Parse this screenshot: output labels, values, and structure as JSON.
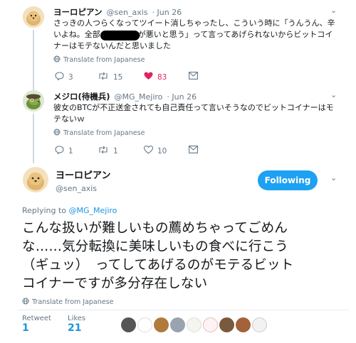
{
  "tweet1": {
    "name": "ヨーロピアン",
    "handle": "@sen_axis",
    "date": "· Jun 26",
    "line1": "さっきの人つらくなってツイート消しちゃったし、こういう時に「うんうん、辛",
    "line2a": "いよね。全部",
    "line2b": "が悪いと思う」って言ってあげられないからビットコイ",
    "line3": "ナーはモテないんだと思いました",
    "translate": "Translate from Japanese",
    "replies": "3",
    "retweets": "15",
    "likes": "83"
  },
  "tweet2": {
    "name": "メジロ(待機兵)",
    "handle": "@MG_Mejiro",
    "date": "· Jun 26",
    "line1": "彼女のBTCが不正送金されても自己責任って言いそうなのでビットコイナーはモ",
    "line2": "テないｗ",
    "translate": "Translate from Japanese",
    "replies": "1",
    "retweets": "1",
    "likes": "10"
  },
  "main": {
    "name": "ヨーロピアン",
    "handle": "@sen_axis",
    "follow_label": "Following",
    "reply_prefix": "Replying to ",
    "reply_handle": "@MG_Mejiro",
    "line1": "こんな扱いが難しいもの薦めちゃってごめん",
    "line2": "な……気分転換に美味しいもの食べに行こう",
    "line3": "（ギュッ）　ってしてあげるのがモテるビット",
    "line4": "コイナーですが多分存在しない",
    "translate": "Translate from Japanese",
    "retweet_label": "Retweet",
    "retweet_count": "1",
    "likes_label": "Likes",
    "likes_count": "21"
  },
  "icons": {
    "reply": "reply-icon",
    "retweet": "retweet-icon",
    "like": "heart-icon",
    "dm": "envelope-icon",
    "caret": "chevron-down-icon",
    "globe": "globe-icon"
  },
  "colors": {
    "accent": "#1da1f2",
    "link": "#1b95e0",
    "like_active": "#e0245e",
    "muted": "#657786"
  }
}
